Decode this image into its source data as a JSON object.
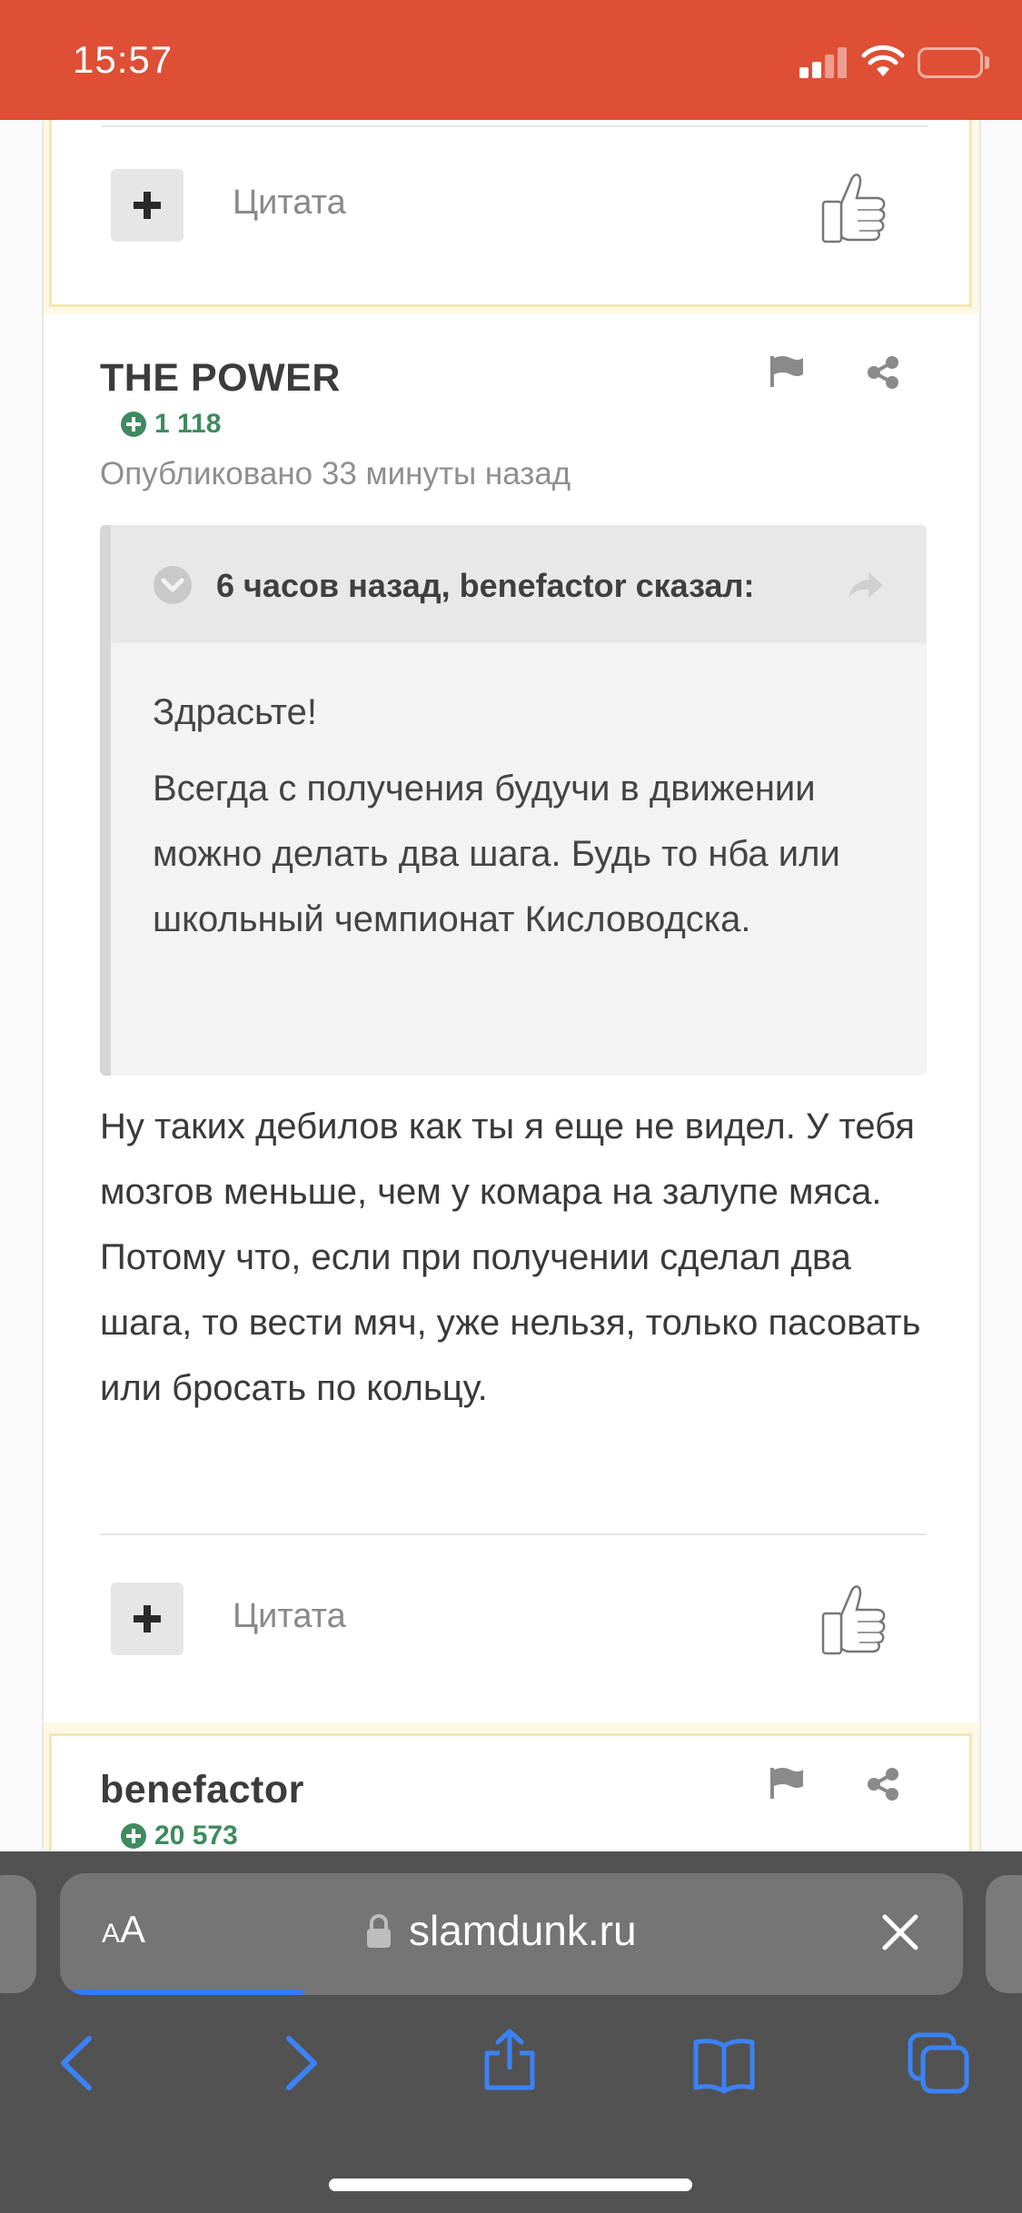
{
  "status_bar": {
    "time": "15:57",
    "background_color": "#de4f35"
  },
  "posts": [
    {
      "quote_label": "Цитата"
    },
    {
      "author": "THE POWER",
      "reputation": "1 118",
      "published": "Опубликовано 33 минуты назад",
      "quote": {
        "header": "6 часов назад, benefactor сказал:",
        "paragraphs": [
          "Здрасьте!",
          "Всегда с получения будучи в движении можно делать два шага. Будь то нба или школьный чемпионат Кисловодска."
        ]
      },
      "body": "Ну таких дебилов как ты я еще не видел. У тебя мозгов меньше, чем у комара на залупе мяса. Потому что, если при получении сделал два шага, то вести мяч, уже нельзя, только пасовать или бросать по кольцу.",
      "quote_label": "Цитата"
    },
    {
      "author": "benefactor",
      "reputation": "20 573"
    }
  ],
  "browser": {
    "text_size_label_small": "A",
    "text_size_label_large": "A",
    "url": "slamdunk.ru",
    "load_progress": 0.27,
    "accent_color": "#2f7cf6",
    "icons": [
      "back-icon",
      "forward-icon",
      "share-icon",
      "bookmarks-icon",
      "tabs-icon"
    ]
  }
}
